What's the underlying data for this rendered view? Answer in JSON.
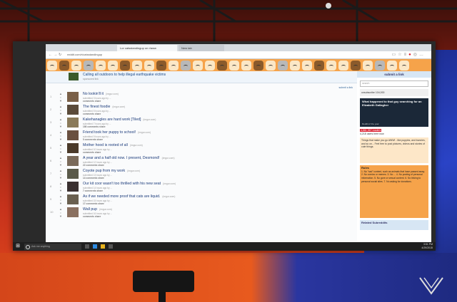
{
  "browser": {
    "tab_active": "Lor catsstandingup on r/aww",
    "tab_inactive": "New tab",
    "url": "reddit.com/r/catsstandingup",
    "nav_icons": [
      "back-icon",
      "forward-icon",
      "refresh-icon"
    ],
    "toolbar_icons": [
      "reading-view-icon",
      "favorites-icon",
      "hub-icon",
      "notes-icon",
      "share-icon",
      "more-icon"
    ]
  },
  "banner": {
    "cat_icons": 30
  },
  "sponsored": {
    "title": "Calling all outdoors to help illegal earthquake victims",
    "meta": "sponsored link",
    "submit_link": "submit a link"
  },
  "posts": [
    {
      "title": "No lookin'll it",
      "domain": "(imgur.com)",
      "meta": "submitted 3 hours ago by ...",
      "links": "comments share"
    },
    {
      "title": "The finest foodie",
      "domain": "(imgur.com)",
      "meta": "submitted 5 hours ago by ...",
      "links": "comments share"
    },
    {
      "title": "Kakehanagles are hard work [Tiled]",
      "domain": "(imgur.com)",
      "meta": "submitted 7 hours ago by ...",
      "links": "198 comments share"
    },
    {
      "title": "Friend took her puppy to school!",
      "domain": "(imgur.com)",
      "meta": "submitted 9 hours ago by ...",
      "links": "5 comments share"
    },
    {
      "title": "Mother hood is rooted of all",
      "domain": "(imgur.com)",
      "meta": "submitted 10 hours ago by ...",
      "links": "comments share"
    },
    {
      "title": "A year and a half old now. I present, Desmond!",
      "domain": "(imgur.com)",
      "meta": "submitted 12 hours ago by ...",
      "links": "22 comments share"
    },
    {
      "title": "Coyote pup from my work",
      "domain": "(imgur.com)",
      "meta": "submitted 13 hours ago by ...",
      "links": "14 comments share"
    },
    {
      "title": "Our kit coor wasn't too thrilled with his new seat",
      "domain": "(imgur.com)",
      "meta": "submitted 14 hours ago by ...",
      "links": "7 comments share"
    },
    {
      "title": "As if we needed more proof that cats are liquid.",
      "domain": "(imgur.com)",
      "meta": "submitted 15 hours ago by ...",
      "links": "17 comments share"
    },
    {
      "title": "Wall pup",
      "domain": "(imgur.com)",
      "meta": "submitted 16 hours ago by ...",
      "links": "comments share"
    }
  ],
  "sidebar": {
    "submit": "submit a link",
    "search_placeholder": "search",
    "subscribe": "unsubscribe  104,000",
    "ad_title": "What happened to that guy searching for an Elizabeth Gallagher",
    "ad_sub": "Reddit of the year",
    "info_line1": "4,861,367 readers",
    "info_line2": "4,218 users here now",
    "box_text": "Things that make you go AWW! - like puppies, and bunnies, and so on... Feel free to post pictures, videos and stories of cute things.",
    "rules_title": "Rules",
    "rules_text": "1. No \"sad\" content, such as animals that have passed away. 2. No comics or memes. 3. No ... 4. No posting of personal information. 5. No gore or sexual content. 6. No linking to personal social sites. 7. No asking for donations.",
    "related": "Related Subreddits"
  },
  "taskbar": {
    "start": "⊞",
    "search_placeholder": "Ask me anything",
    "time": "3:51 PM",
    "date": "4/29/2015"
  }
}
